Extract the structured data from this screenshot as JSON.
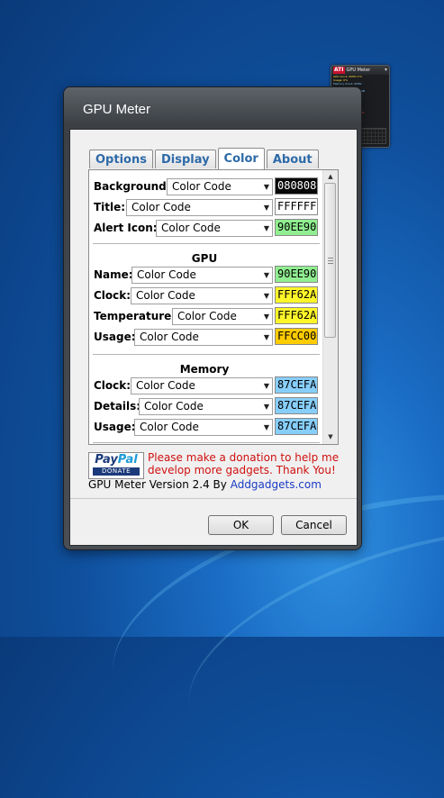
{
  "gadget": {
    "logo": "ATI",
    "title": "GPU Meter",
    "rows": [
      {
        "text": "GPU Clock: 0MHz        0°C",
        "color": "#ffe04a"
      },
      {
        "text": "Usage: 0%",
        "color": "#ffe04a"
      },
      {
        "text": "Memory Clock: 0MHz",
        "color": "#87cefa"
      },
      {
        "text": "Used      Free     Total",
        "color": "#87cefa"
      },
      {
        "text": "0.00GB   0.00GB   0.00GB",
        "color": "#87cefa"
      },
      {
        "text": "Usage: 0%",
        "color": "#87cefa"
      },
      {
        "text": "Fan Speed: 0rpm",
        "color": "#90ee90"
      },
      {
        "text": "Usage: 0%",
        "color": "#90ee90"
      },
      {
        "text": "Shader Clock: 0MHz",
        "color": "#ffe04a"
      },
      {
        "text": "PCB Temp: 0°C",
        "color": "#ff8080"
      },
      {
        "text": "Memory Controller: 0%",
        "color": "#ff4040"
      }
    ]
  },
  "dialog": {
    "title": "GPU Meter",
    "tabs": [
      "Options",
      "Display",
      "Color",
      "About"
    ],
    "active_tab": "Color",
    "general": [
      {
        "label": "Background:",
        "select": "Color Code",
        "code": "080808",
        "bg": "#080808",
        "fg": "#ffffff"
      },
      {
        "label": "Title:",
        "select": "Color Code",
        "code": "FFFFFF",
        "bg": "#ffffff",
        "fg": "#000000"
      },
      {
        "label": "Alert Icon:",
        "select": "Color Code",
        "code": "90EE90",
        "bg": "#90ee90",
        "fg": "#000000"
      }
    ],
    "gpu_heading": "GPU",
    "gpu": [
      {
        "label": "Name:",
        "select": "Color Code",
        "code": "90EE90",
        "bg": "#90ee90",
        "fg": "#000000"
      },
      {
        "label": "Clock:",
        "select": "Color Code",
        "code": "FFF62A",
        "bg": "#fff62a",
        "fg": "#000000"
      },
      {
        "label": "Temperature:",
        "select": "Color Code",
        "code": "FFF62A",
        "bg": "#fff62a",
        "fg": "#000000"
      },
      {
        "label": "Usage:",
        "select": "Color Code",
        "code": "FFCC00",
        "bg": "#ffcc00",
        "fg": "#000000"
      }
    ],
    "memory_heading": "Memory",
    "memory": [
      {
        "label": "Clock:",
        "select": "Color Code",
        "code": "87CEFA",
        "bg": "#87cefa",
        "fg": "#000000"
      },
      {
        "label": "Details:",
        "select": "Color Code",
        "code": "87CEFA",
        "bg": "#87cefa",
        "fg": "#000000"
      },
      {
        "label": "Usage:",
        "select": "Color Code",
        "code": "87CEFA",
        "bg": "#87cefa",
        "fg": "#000000"
      }
    ],
    "donate": {
      "paypal_a": "Pay",
      "paypal_b": "Pal",
      "donate": "DONATE"
    },
    "message_line1": "Please make a donation to help me",
    "message_line2": "develop more gadgets. Thank You!",
    "version_text": "GPU Meter Version 2.4 By ",
    "version_link": "Addgadgets.com",
    "ok_label": "OK",
    "cancel_label": "Cancel"
  }
}
